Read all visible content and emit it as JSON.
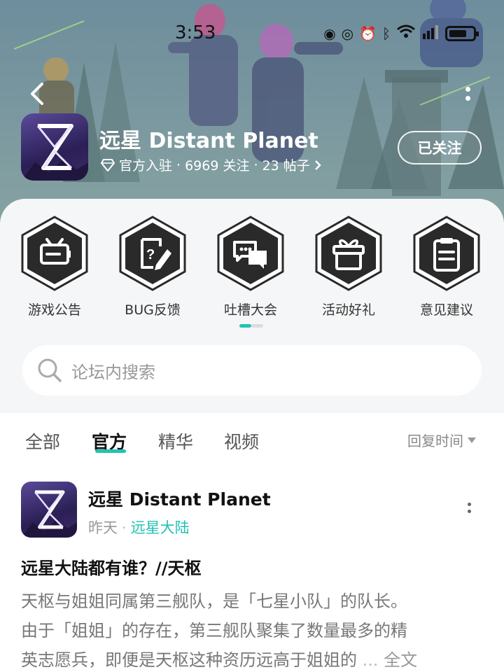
{
  "status_bar": {
    "time": "3:53",
    "icons": [
      "nfc-icon",
      "eye-icon",
      "alarm-icon",
      "bluetooth-icon",
      "wifi-icon",
      "signal-5g-icon",
      "battery-icon"
    ]
  },
  "header": {
    "app_name": "远星 Distant Planet",
    "verified_label": "官方入驻",
    "followers": "6969 关注",
    "posts": "23 帖子",
    "follow_button": "已关注"
  },
  "quick_links": [
    {
      "label": "游戏公告",
      "icon": "announcement-icon"
    },
    {
      "label": "BUG反馈",
      "icon": "bug-report-icon"
    },
    {
      "label": "吐槽大会",
      "icon": "chat-bubbles-icon"
    },
    {
      "label": "活动好礼",
      "icon": "gift-box-icon"
    },
    {
      "label": "意见建议",
      "icon": "clipboard-icon"
    }
  ],
  "search": {
    "placeholder": "论坛内搜索"
  },
  "tabs": [
    {
      "label": "全部",
      "active": false
    },
    {
      "label": "官方",
      "active": true
    },
    {
      "label": "精华",
      "active": false
    },
    {
      "label": "视频",
      "active": false
    }
  ],
  "sort": {
    "label": "回复时间"
  },
  "post": {
    "author": "远星 Distant Planet",
    "time": "昨天",
    "board": "远星大陆",
    "title": "远星大陆都有谁？//天枢",
    "body_lines": [
      "天枢与姐姐同属第三舰队，是「七星小队」的队长。",
      "由于「姐姐」的存在，第三舰队聚集了数量最多的精",
      "英志愿兵，即便是天枢这种资历远高于姐姐的"
    ],
    "ellipsis": "...",
    "full_text": "全文"
  },
  "colors": {
    "accent": "#22c2b3",
    "panel_bg": "#f5f6f7",
    "hex_dark": "#2a2a2a"
  }
}
